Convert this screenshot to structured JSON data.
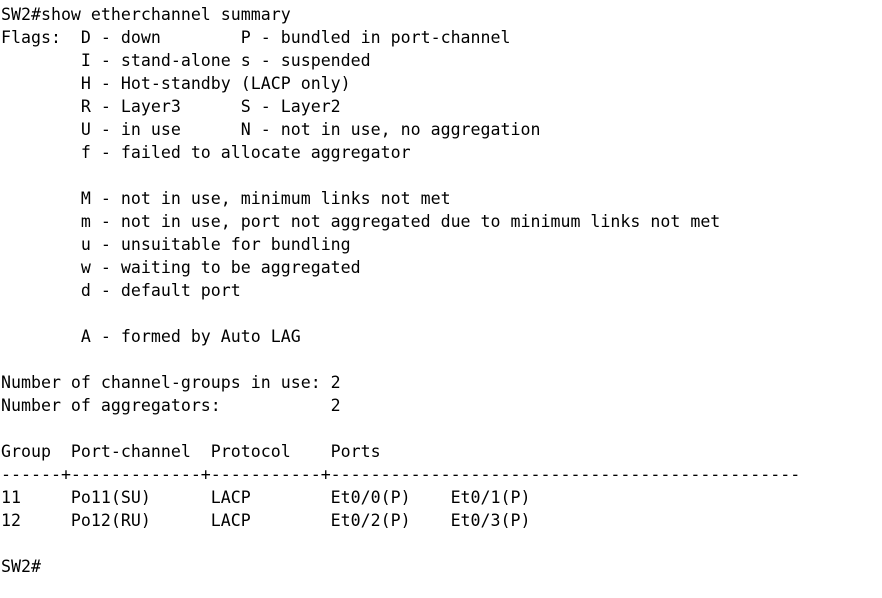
{
  "terminal": {
    "background_color": "#ffffff",
    "text_color": "#000000",
    "hostname": "SW2",
    "prompt_symbol": "#",
    "command": "show etherchannel summary",
    "command_line": "SW2#show etherchannel summary",
    "prompt_line": "SW2#",
    "lines": [
      "SW2#show etherchannel summary",
      "Flags:  D - down        P - bundled in port-channel",
      "        I - stand-alone s - suspended",
      "        H - Hot-standby (LACP only)",
      "        R - Layer3      S - Layer2",
      "        U - in use      N - not in use, no aggregation",
      "        f - failed to allocate aggregator",
      "",
      "        M - not in use, minimum links not met",
      "        m - not in use, port not aggregated due to minimum links not met",
      "        u - unsuitable for bundling",
      "        w - waiting to be aggregated",
      "        d - default port",
      "",
      "        A - formed by Auto LAG",
      "",
      "Number of channel-groups in use: 2",
      "Number of aggregators:           2",
      "",
      "Group  Port-channel  Protocol    Ports",
      "------+-------------+-----------+-----------------------------------------------",
      "11     Po11(SU)      LACP        Et0/0(P)    Et0/1(P)",
      "12     Po12(RU)      LACP        Et0/2(P)    Et0/3(P)",
      "",
      "SW2#"
    ],
    "flags_label": "Flags:",
    "flag_legend": [
      {
        "code": "D",
        "description": "down"
      },
      {
        "code": "P",
        "description": "bundled in port-channel"
      },
      {
        "code": "I",
        "description": "stand-alone"
      },
      {
        "code": "s",
        "description": "suspended"
      },
      {
        "code": "H",
        "description": "Hot-standby (LACP only)"
      },
      {
        "code": "R",
        "description": "Layer3"
      },
      {
        "code": "S",
        "description": "Layer2"
      },
      {
        "code": "U",
        "description": "in use"
      },
      {
        "code": "N",
        "description": "not in use, no aggregation"
      },
      {
        "code": "f",
        "description": "failed to allocate aggregator"
      },
      {
        "code": "M",
        "description": "not in use, minimum links not met"
      },
      {
        "code": "m",
        "description": "not in use, port not aggregated due to minimum links not met"
      },
      {
        "code": "u",
        "description": "unsuitable for bundling"
      },
      {
        "code": "w",
        "description": "waiting to be aggregated"
      },
      {
        "code": "d",
        "description": "default port"
      },
      {
        "code": "A",
        "description": "formed by Auto LAG"
      }
    ],
    "summary": {
      "channel_groups_label": "Number of channel-groups in use:",
      "channel_groups_value": "2",
      "aggregators_label": "Number of aggregators:",
      "aggregators_value": "2"
    },
    "table": {
      "headers": [
        "Group",
        "Port-channel",
        "Protocol",
        "Ports"
      ],
      "separator": "------+-------------+-----------+-----------------------------------------------",
      "rows": [
        {
          "group": "11",
          "port_channel": "Po11(SU)",
          "protocol": "LACP",
          "ports": [
            "Et0/0(P)",
            "Et0/1(P)"
          ]
        },
        {
          "group": "12",
          "port_channel": "Po12(RU)",
          "protocol": "LACP",
          "ports": [
            "Et0/2(P)",
            "Et0/3(P)"
          ]
        }
      ]
    }
  }
}
